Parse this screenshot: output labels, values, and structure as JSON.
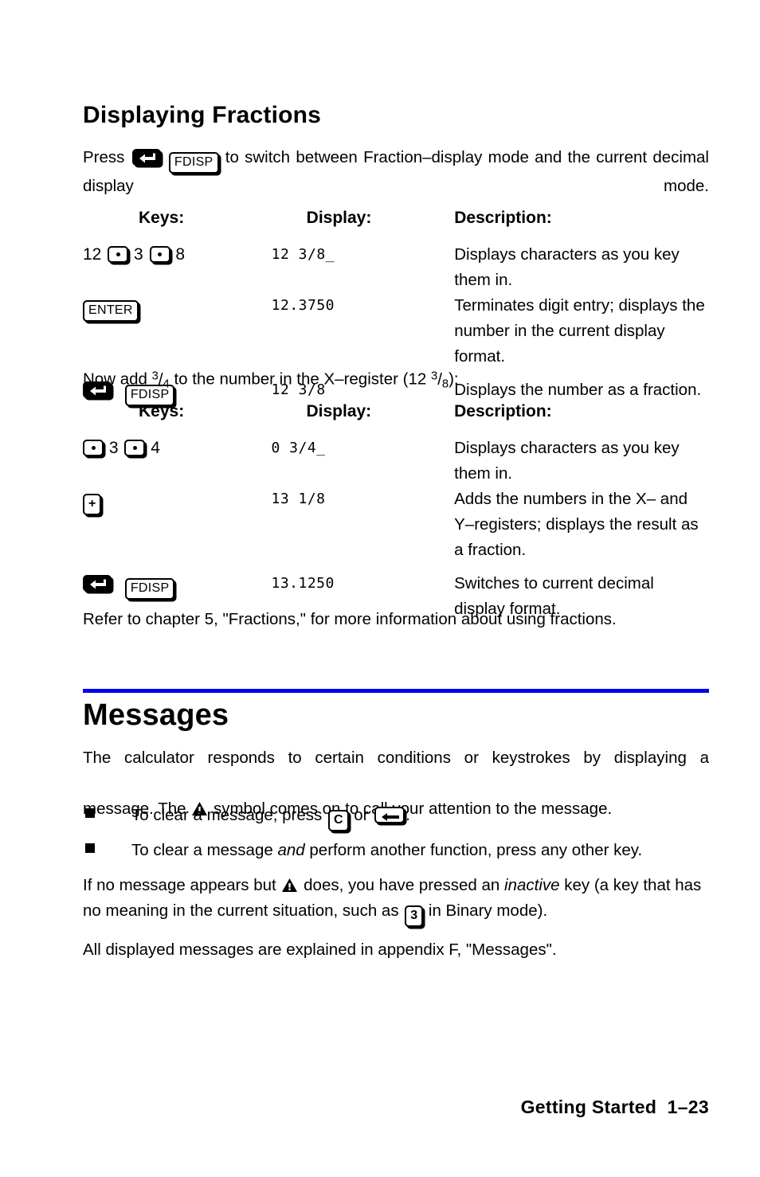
{
  "document": {
    "section1": {
      "heading": "Displaying Fractions",
      "intro_before": "Press",
      "intro_after": "to switch between Fraction–display mode and the current decimal display mode.",
      "table_headers": {
        "keys": "Keys:",
        "display": "Display:",
        "description": "Description:"
      },
      "rows": [
        {
          "keys_text_1": "12",
          "keys_text_2": "3",
          "keys_text_3": "8",
          "display": "12 3/8_",
          "description": "Displays characters as you key them in."
        },
        {
          "key_label": "ENTER",
          "display": "12.3750",
          "description": "Terminates digit entry; displays the number in the current display format."
        },
        {
          "key_label": "FDISP",
          "display": "12 3/8",
          "description": "Displays the number as a fraction."
        }
      ],
      "transition": {
        "before": "Now add",
        "frac1": {
          "numerator": "3",
          "denominator": "4"
        },
        "middle": "to the number in the X–register (12",
        "frac2": {
          "numerator": "3",
          "denominator": "8"
        },
        "after": "):"
      },
      "table2_headers": {
        "keys": "Keys:",
        "display": "Display:",
        "description": "Description:"
      },
      "rows2": [
        {
          "keys_text_1": "3",
          "keys_text_2": "4",
          "display": "0 3/4_",
          "description": "Displays characters as you key them in."
        },
        {
          "key_label": "+",
          "display": "13 1/8",
          "description": "Adds the numbers in the X– and Y–registers; displays the result as a fraction."
        },
        {
          "key_label": "FDISP",
          "display": "13.1250",
          "description": "Switches to current decimal display format."
        }
      ],
      "closing": "Refer to chapter 5, \"Fractions,\" for more information about using fractions."
    },
    "section2": {
      "heading": "Messages",
      "para1_line1": "The calculator responds to certain conditions or keystrokes by displaying a",
      "para1_line2_a": "message. The",
      "para1_line2_b": "symbol comes on to call your attention to the message.",
      "bullets": [
        {
          "text_before": "To clear a message, press",
          "key1": "C",
          "text_middle": "or",
          "text_after": "."
        },
        {
          "text_before": "To clear a message",
          "emphasis": "and",
          "text_after": "perform another function, press any other key."
        }
      ],
      "para2_a": "If no message appears but",
      "para2_b": "does, you have pressed an",
      "para2_em": "inactive",
      "para2_c": "key (a key that has no meaning in the current situation, such as",
      "para2_key": "3",
      "para2_d": "in Binary mode).",
      "para3": "All displayed messages are explained in appendix F, \"Messages\"."
    },
    "footer": {
      "chapter": "Getting Started",
      "page": "1–23"
    },
    "icons": {
      "shift_key": "shift-left-arrow-icon",
      "decimal_key": "decimal-point-icon",
      "warning": "warning-triangle-icon",
      "backspace": "backspace-arrow-icon"
    },
    "colors": {
      "rule": "#0000ee",
      "text": "#000000",
      "background": "#ffffff"
    }
  }
}
